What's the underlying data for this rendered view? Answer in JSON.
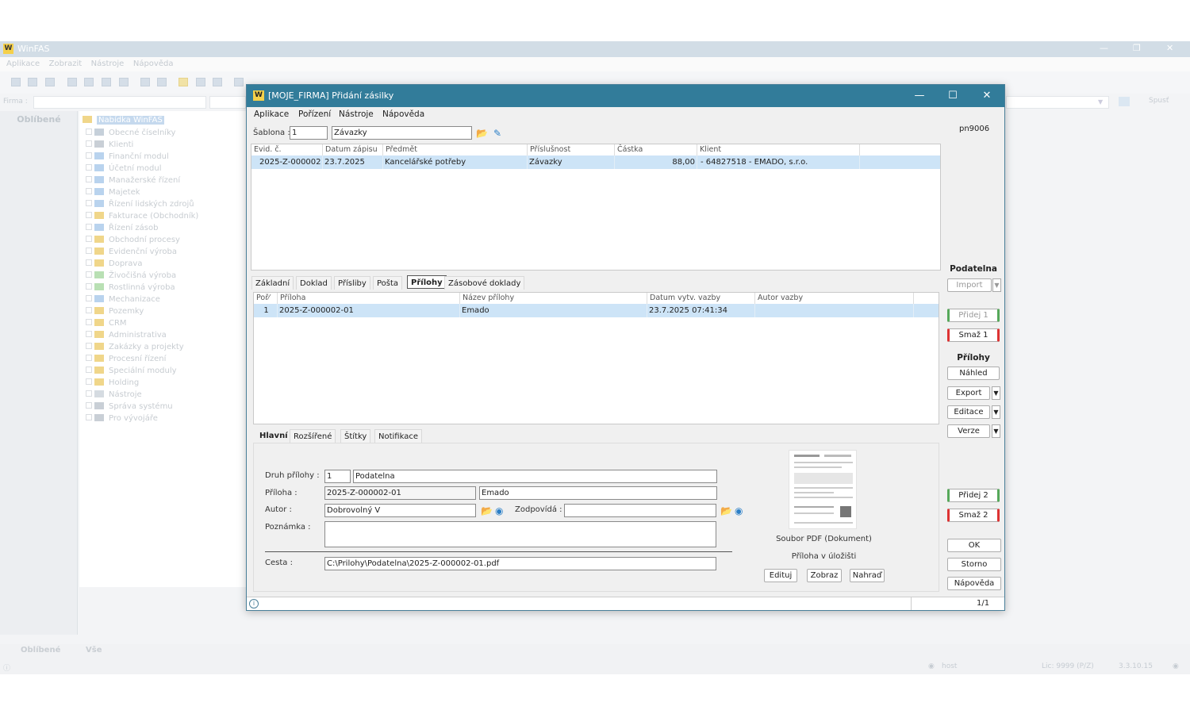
{
  "background_app": {
    "title": "WinFAS",
    "menu": [
      "Aplikace",
      "Zobrazit",
      "Nástroje",
      "Nápověda"
    ],
    "firma_label": "Firma :",
    "spust_label": "Spusť",
    "left_panel_title": "Oblíbené",
    "tree_root": "Nabídka WinFAS",
    "tree_items": [
      "Obecné číselníky",
      "Klienti",
      "Finanční modul",
      "Účetní modul",
      "Manažerské řízení",
      "Majetek",
      "Řízení lidských zdrojů",
      "Fakturace (Obchodník)",
      "Řízení zásob",
      "Obchodní procesy",
      "Evidenční výroba",
      "Doprava",
      "Živočišná výroba",
      "Rostlinná výroba",
      "Mechanizace",
      "Pozemky",
      "CRM",
      "Administrativa",
      "Zakázky a projekty",
      "Procesní řízení",
      "Speciální moduly",
      "Holding",
      "Nástroje",
      "Správa systému",
      "Pro vývojáře"
    ],
    "bottom_tabs": [
      "Oblíbené",
      "Vše"
    ],
    "status": {
      "user": "host",
      "lic": "Lic: 9999 (P/Z)",
      "version": "3.3.10.15"
    }
  },
  "dialog": {
    "title": "[MOJE_FIRMA] Přidání zásilky",
    "menu": [
      "Aplikace",
      "Pořízení",
      "Nástroje",
      "Nápověda"
    ],
    "user_code": "pn9006",
    "sablona_label": "Šablona :",
    "sablona_num": "1",
    "sablona_name": "Závazky",
    "main_grid": {
      "columns": [
        "Evid. č.",
        "Datum zápisu",
        "Předmět",
        "Příslušnost",
        "Částka",
        "Klient"
      ],
      "row": [
        "2025-Z-000002",
        "23.7.2025",
        "Kancelářské potřeby",
        "Závazky",
        "88,00",
        "- 64827518  - EMADO, s.r.o."
      ]
    },
    "tabs1": [
      "Základní",
      "Doklad",
      "Přísliby",
      "Pošta",
      "Přílohy",
      "Zásobové doklady"
    ],
    "attach_grid": {
      "columns": [
        "Poř⁄",
        "Příloha",
        "Název přílohy",
        "Datum vytv. vazby",
        "Autor vazby"
      ],
      "row": [
        "1",
        "2025-Z-000002-01",
        "Emado",
        "23.7.2025 07:41:34",
        ""
      ]
    },
    "tabs2": [
      "Hlavní",
      "Rozšířené",
      "Štítky",
      "Notifikace"
    ],
    "form": {
      "druh_label": "Druh přílohy :",
      "druh_num": "1",
      "druh_name": "Podatelna",
      "priloha_label": "Příloha :",
      "priloha_value": "2025-Z-000002-01",
      "priloha_name": "Emado",
      "autor_label": "Autor :",
      "autor_value": "Dobrovolný V",
      "zodpovida_label": "Zodpovídá :",
      "zodpovida_value": "",
      "poznamka_label": "Poznámka :",
      "poznamka_value": "",
      "cesta_label": "Cesta :",
      "cesta_value": "C:\\Prilohy\\Podatelna\\2025-Z-000002-01.pdf"
    },
    "preview": {
      "file_type": "Soubor PDF (Dokument)",
      "storage": "Příloha v úložišti",
      "buttons": [
        "Edituj",
        "Zobraz",
        "Nahraď"
      ]
    },
    "right": {
      "podatelna_title": "Podatelna",
      "import_label": "Import",
      "pridej1": "Přidej 1",
      "smaz1": "Smaž 1",
      "prilohy_title": "Přílohy",
      "nahled": "Náhled",
      "export": "Export",
      "editace": "Editace",
      "verze": "Verze",
      "pridej2": "Přidej 2",
      "smaz2": "Smaž 2",
      "ok": "OK",
      "storno": "Storno",
      "napoveda": "Nápověda"
    },
    "status_page": "1/1"
  }
}
